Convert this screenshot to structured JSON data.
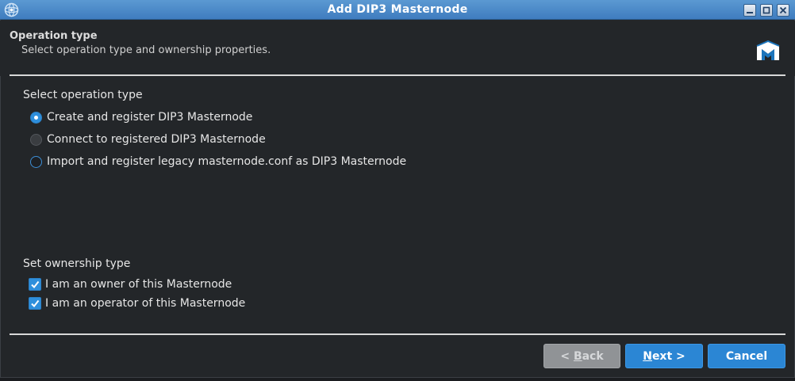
{
  "window": {
    "title": "Add DIP3 Masternode",
    "app_icon": "dash-electrum-icon",
    "controls": [
      "minimize-icon",
      "maximize-icon",
      "close-icon"
    ]
  },
  "header": {
    "title": "Operation type",
    "subtitle": "Select operation type and ownership properties.",
    "logo": "dash-logo-icon"
  },
  "operation": {
    "label": "Select operation type",
    "options": [
      {
        "label": "Create and register DIP3 Masternode",
        "state": "checked"
      },
      {
        "label": "Connect to registered DIP3 Masternode",
        "state": "disabled"
      },
      {
        "label": "Import and register legacy masternode.conf as DIP3 Masternode",
        "state": "unchecked"
      }
    ]
  },
  "ownership": {
    "label": "Set ownership type",
    "options": [
      {
        "label": "I am an owner of this Masternode",
        "checked": true
      },
      {
        "label": "I am an operator of this Masternode",
        "checked": true
      }
    ]
  },
  "buttons": {
    "back": {
      "prefix": "< ",
      "mnemonic": "B",
      "rest": "ack",
      "enabled": false
    },
    "next": {
      "mnemonic": "N",
      "rest": "ext >",
      "enabled": true
    },
    "cancel": {
      "label": "Cancel",
      "enabled": true
    }
  },
  "colors": {
    "accent": "#2e8fdc",
    "titlebar": "#4a89c8",
    "background": "#232629"
  }
}
